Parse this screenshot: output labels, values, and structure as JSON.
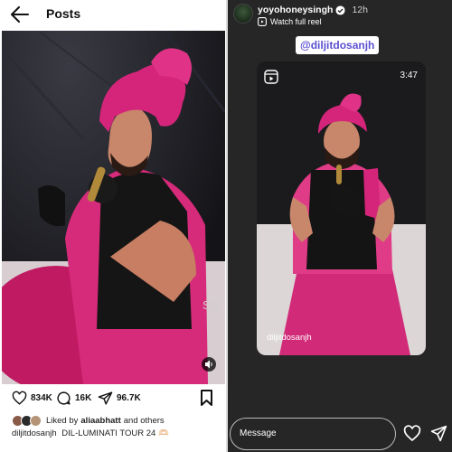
{
  "post": {
    "title": "Posts",
    "likes": "834K",
    "comments": "16K",
    "shares": "96.7K",
    "liked_by_prefix": "Liked by",
    "liked_by_user": "aliaabhatt",
    "liked_by_suffix": "and others",
    "caption_user": "diljitdosanjh",
    "caption_text": "DIL-LUMINATI TOUR 24",
    "caption_emoji": "🫶🏻"
  },
  "story": {
    "username": "yoyohoneysingh",
    "time": "12h",
    "watch_label": "Watch full reel",
    "mention": "@diljitdosanjh",
    "reel_duration": "3:47",
    "reel_username": "diljitdosanjh",
    "message_placeholder": "Message"
  },
  "icons": [
    "back-arrow-icon",
    "heart-icon",
    "comment-icon",
    "share-icon",
    "bookmark-icon",
    "mute-icon",
    "verified-icon",
    "reel-icon",
    "send-icon"
  ],
  "colors": {
    "turban_pink": "#d4257a",
    "mention_text": "#5a4fd1",
    "story_bg": "#262626"
  }
}
